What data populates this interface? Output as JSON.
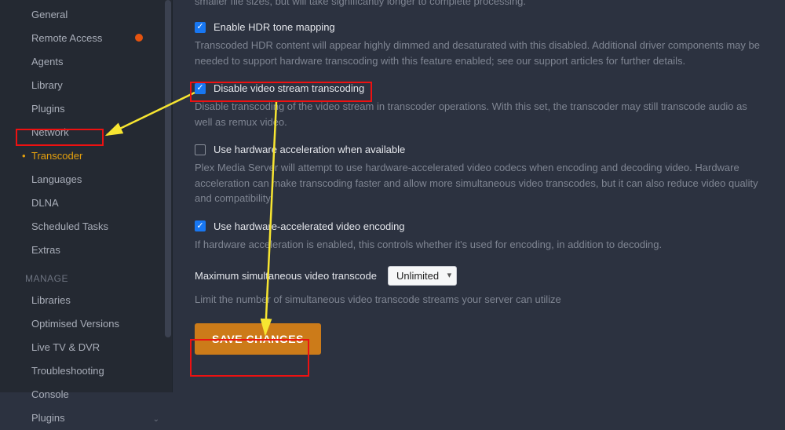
{
  "sidebar": {
    "items": [
      {
        "label": "General"
      },
      {
        "label": "Remote Access",
        "badge": true
      },
      {
        "label": "Agents"
      },
      {
        "label": "Library"
      },
      {
        "label": "Plugins"
      },
      {
        "label": "Network"
      },
      {
        "label": "Transcoder",
        "active": true
      },
      {
        "label": "Languages"
      },
      {
        "label": "DLNA"
      },
      {
        "label": "Scheduled Tasks"
      },
      {
        "label": "Extras"
      }
    ],
    "manage_header": "MANAGE",
    "manage_items": [
      {
        "label": "Libraries"
      },
      {
        "label": "Optimised Versions"
      },
      {
        "label": "Live TV & DVR"
      },
      {
        "label": "Troubleshooting"
      },
      {
        "label": "Console"
      },
      {
        "label": "Plugins",
        "chevron": true
      }
    ]
  },
  "main": {
    "truncated_top": "smaller file sizes, but will take significantly longer to complete processing.",
    "settings": [
      {
        "label": "Enable HDR tone mapping",
        "checked": true,
        "help": "Transcoded HDR content will appear highly dimmed and desaturated with this disabled. Additional driver components may be needed to support hardware transcoding with this feature enabled; see our support articles for further details."
      },
      {
        "label": "Disable video stream transcoding",
        "checked": true,
        "help": "Disable transcoding of the video stream in transcoder operations. With this set, the transcoder may still transcode audio as well as remux video."
      },
      {
        "label": "Use hardware acceleration when available",
        "checked": false,
        "help": "Plex Media Server will attempt to use hardware-accelerated video codecs when encoding and decoding video. Hardware acceleration can make transcoding faster and allow more simultaneous video transcodes, but it can also reduce video quality and compatibility."
      },
      {
        "label": "Use hardware-accelerated video encoding",
        "checked": true,
        "help": "If hardware acceleration is enabled, this controls whether it's used for encoding, in addition to decoding."
      }
    ],
    "max_transcode": {
      "label": "Maximum simultaneous video transcode",
      "value": "Unlimited",
      "help": "Limit the number of simultaneous video transcode streams your server can utilize"
    },
    "save_button": "SAVE CHANGES"
  }
}
